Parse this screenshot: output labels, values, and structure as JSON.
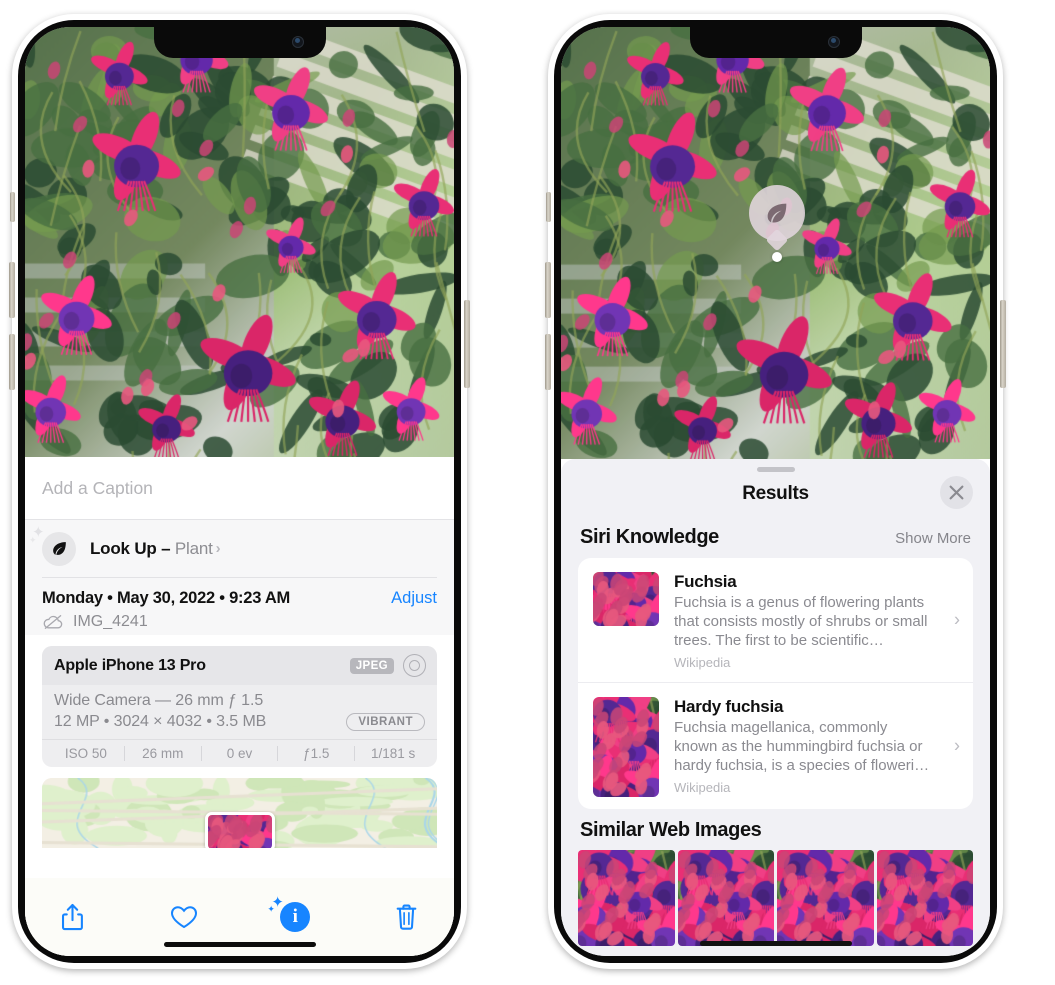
{
  "left_phone": {
    "caption_placeholder": "Add a Caption",
    "lookup": {
      "label": "Look Up",
      "dash": "–",
      "subject": "Plant",
      "chevron": "›",
      "icon": "leaf-sparkle-icon"
    },
    "meta": {
      "date": "Monday • May 30, 2022 • 9:23 AM",
      "adjust": "Adjust",
      "filename": "IMG_4241"
    },
    "camera": {
      "device": "Apple iPhone 13 Pro",
      "format_badge": "JPEG",
      "hdr_icon": "concentric-circle-icon",
      "lens": "Wide Camera — 26 mm ƒ 1.5",
      "specs": "12 MP • 3024 × 4032 • 3.5 MB",
      "profile_badge": "VIBRANT",
      "exif": [
        "ISO 50",
        "26 mm",
        "0 ev",
        "ƒ1.5",
        "1/181 s"
      ]
    },
    "toolbar": {
      "share": "share-icon",
      "favorite": "heart-icon",
      "info": "info-sparkle-icon",
      "delete": "trash-icon"
    }
  },
  "right_phone": {
    "visual_lookup_badge": "leaf-icon",
    "sheet": {
      "title": "Results",
      "close": "✕",
      "sections": [
        {
          "title": "Siri Knowledge",
          "action": "Show More",
          "items": [
            {
              "title": "Fuchsia",
              "description": "Fuchsia is a genus of flowering plants that consists mostly of shrubs or small trees. The first to be scientific…",
              "source": "Wikipedia",
              "chevron": "›"
            },
            {
              "title": "Hardy fuchsia",
              "description": "Fuchsia magellanica, commonly known as the hummingbird fuchsia or hardy fuchsia, is a species of floweri…",
              "source": "Wikipedia",
              "chevron": "›"
            }
          ]
        },
        {
          "title": "Similar Web Images",
          "items": [
            "image-1",
            "image-2",
            "image-3",
            "image-4"
          ]
        }
      ]
    }
  },
  "colors": {
    "accent_blue": "#1785ff",
    "sheet_bg": "#f1f1f5",
    "card_bg": "#ffffff",
    "secondary_text": "#8a8a90"
  }
}
